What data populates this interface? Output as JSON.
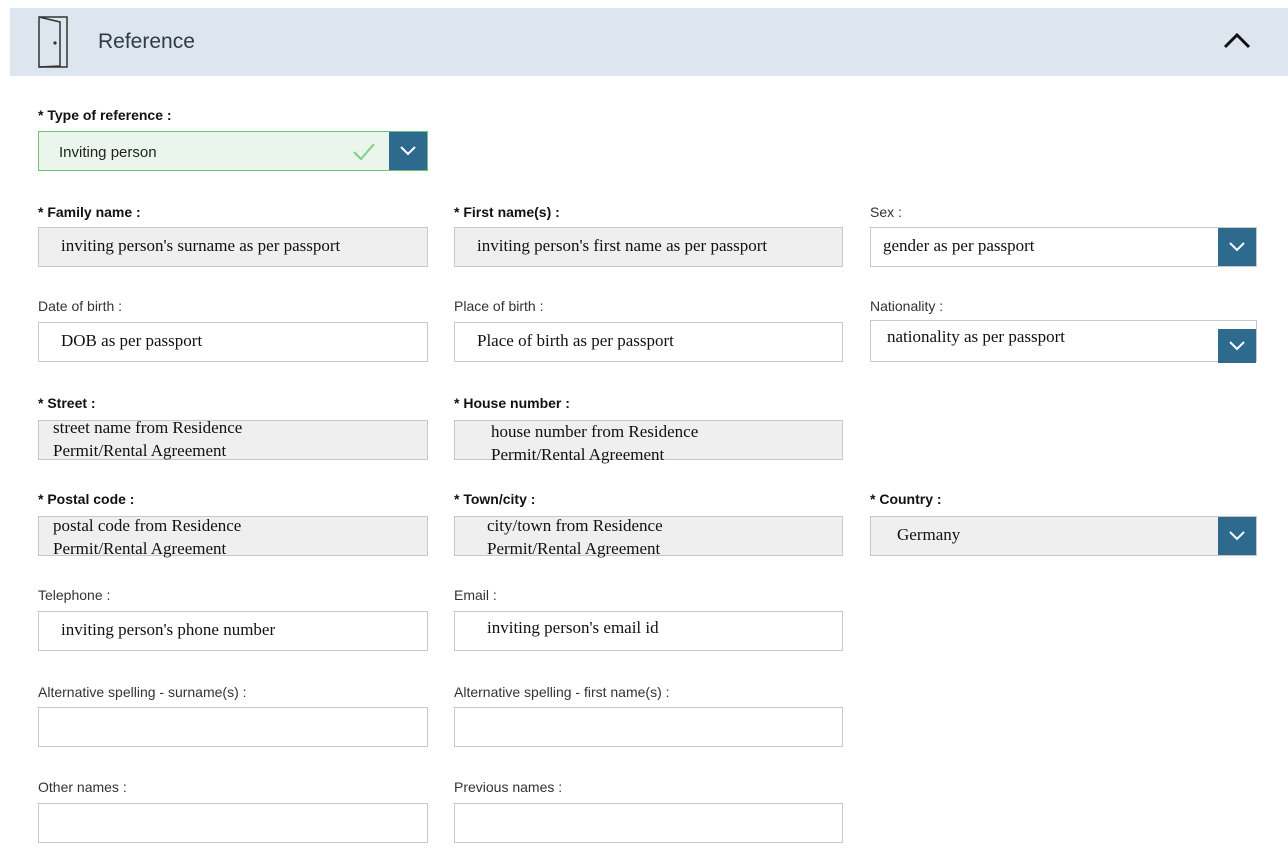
{
  "section": {
    "title": "Reference"
  },
  "colors": {
    "header_bg": "#dde6ee",
    "dropdown_button": "#2e6a8e",
    "valid_border": "#6cc27a",
    "readonly_bg": "#efefef"
  },
  "icons": {
    "section_icon": "door-icon",
    "collapse": "chevron-up-icon",
    "valid": "checkmark-icon",
    "dropdown": "chevron-down-icon"
  },
  "type_of_reference": {
    "label": "* Type of reference :",
    "value": "Inviting person"
  },
  "family_name": {
    "label": "* Family name :",
    "value": "inviting person's surname as per passport"
  },
  "first_name": {
    "label": "* First name(s) :",
    "value": "inviting person's first name as per passport"
  },
  "sex": {
    "label": "Sex :",
    "value": "gender as per passport"
  },
  "date_of_birth": {
    "label": "Date of birth :",
    "value": "DOB as per passport"
  },
  "place_of_birth": {
    "label": "Place of birth :",
    "value": "Place of birth as per passport"
  },
  "nationality": {
    "label": "Nationality :",
    "value": "nationality as per passport"
  },
  "street": {
    "label": "* Street :",
    "line1": "street name from Residence",
    "line2": "Permit/Rental Agreement"
  },
  "house_number": {
    "label": "* House number :",
    "line1": "house number from Residence",
    "line2": "Permit/Rental Agreement"
  },
  "postal_code": {
    "label": "* Postal code :",
    "line1": "postal code from Residence",
    "line2": "Permit/Rental Agreement"
  },
  "town_city": {
    "label": "* Town/city :",
    "line1": "city/town  from Residence",
    "line2": "Permit/Rental Agreement"
  },
  "country": {
    "label": "* Country :",
    "value": "Germany"
  },
  "telephone": {
    "label": "Telephone :",
    "value": "inviting person's phone number"
  },
  "email": {
    "label": "Email :",
    "value": "inviting person's email id"
  },
  "alt_surname": {
    "label": "Alternative spelling - surname(s) :",
    "value": ""
  },
  "alt_first_name": {
    "label": "Alternative spelling - first name(s) :",
    "value": ""
  },
  "other_names": {
    "label": "Other names :",
    "value": ""
  },
  "previous_names": {
    "label": "Previous names :",
    "value": ""
  }
}
